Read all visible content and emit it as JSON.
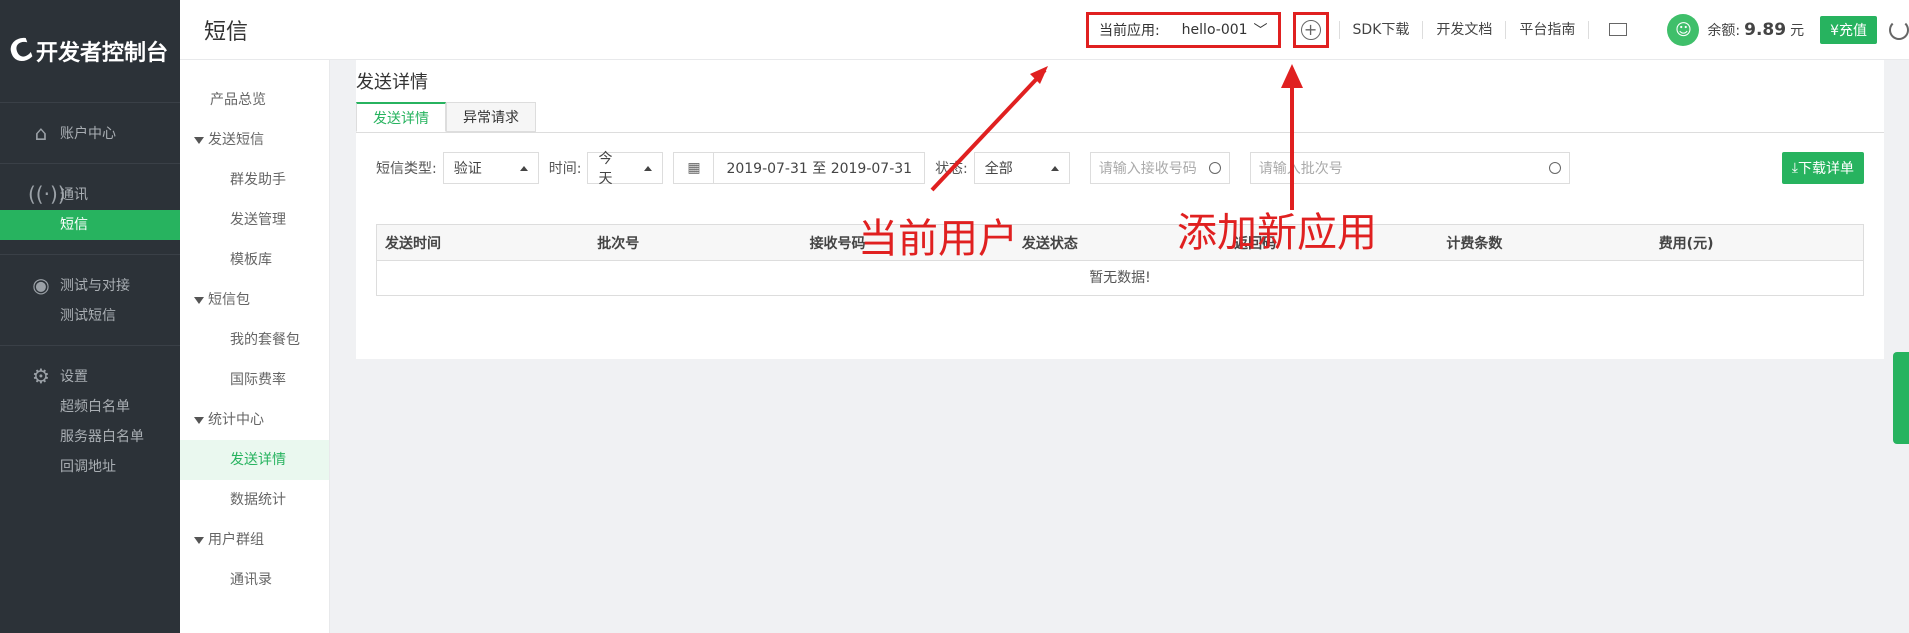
{
  "brand": {
    "logo_text": "开发者控制台"
  },
  "leftnav": {
    "groups": [
      {
        "label": "账户中心",
        "icon": "home-icon",
        "subs": []
      },
      {
        "label": "通讯",
        "icon": "signal-icon",
        "subs": [
          "短信"
        ]
      },
      {
        "label": "测试与对接",
        "icon": "test-icon",
        "subs": [
          "测试短信"
        ]
      },
      {
        "label": "设置",
        "icon": "gear-icon",
        "subs": [
          "超频白名单",
          "服务器白名单",
          "回调地址"
        ]
      }
    ],
    "active": "短信"
  },
  "subnav": {
    "items": [
      {
        "label": "产品总览",
        "type": "top"
      },
      {
        "label": "发送短信",
        "type": "cat"
      },
      {
        "label": "群发助手",
        "type": "child"
      },
      {
        "label": "发送管理",
        "type": "child"
      },
      {
        "label": "模板库",
        "type": "child"
      },
      {
        "label": "短信包",
        "type": "cat"
      },
      {
        "label": "我的套餐包",
        "type": "child"
      },
      {
        "label": "国际费率",
        "type": "child"
      },
      {
        "label": "统计中心",
        "type": "cat"
      },
      {
        "label": "发送详情",
        "type": "child",
        "active": true
      },
      {
        "label": "数据统计",
        "type": "child"
      },
      {
        "label": "用户群组",
        "type": "cat"
      },
      {
        "label": "通讯录",
        "type": "child"
      }
    ]
  },
  "topbar": {
    "page_title": "短信",
    "app_label": "当前应用:",
    "app_value": "hello-001",
    "add_app": "⊕",
    "links": [
      "SDK下载",
      "开发文档",
      "平台指南"
    ],
    "balance_label": "余额:",
    "balance_value": "9.89",
    "balance_unit": "元",
    "recharge": "¥充值"
  },
  "content": {
    "title": "发送详情",
    "tabs": [
      "发送详情",
      "异常请求"
    ],
    "filters": {
      "type_label": "短信类型:",
      "type_value": "验证",
      "time_label": "时间:",
      "time_value": "今天",
      "date_range": "2019-07-31 至 2019-07-31",
      "status_label": "状态:",
      "status_value": "全部",
      "phone_placeholder": "请输入接收号码",
      "batch_placeholder": "请输入批次号",
      "download": "下载详单"
    },
    "table": {
      "columns": [
        "发送时间",
        "批次号",
        "接收号码",
        "发送状态",
        "返回码",
        "计费条数",
        "费用(元)"
      ],
      "empty_text": "暂无数据!"
    }
  },
  "annotations": {
    "current_user": "当前用户",
    "add_new_app": "添加新应用"
  },
  "colors": {
    "accent": "#27b35f",
    "annotation": "#e02020",
    "nav_bg": "#2c3238"
  }
}
